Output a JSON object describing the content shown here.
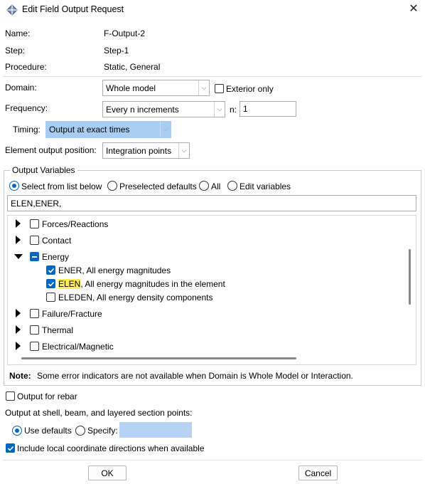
{
  "window": {
    "title": "Edit Field Output Request",
    "close_glyph": "✕"
  },
  "info": {
    "name_label": "Name:",
    "name_value": "F-Output-2",
    "step_label": "Step:",
    "step_value": "Step-1",
    "procedure_label": "Procedure:",
    "procedure_value": "Static, General"
  },
  "domain": {
    "label": "Domain:",
    "value": "Whole model",
    "exterior_label": "Exterior only",
    "exterior_checked": false
  },
  "frequency": {
    "label": "Frequency:",
    "value": "Every n increments",
    "n_label": "n:",
    "n_value": "1"
  },
  "timing": {
    "label": "Timing:",
    "value": "Output at exact times"
  },
  "element_position": {
    "label": "Element output position:",
    "value": "Integration points"
  },
  "output_variables": {
    "group_label": "Output Variables",
    "mode_options": [
      "Select from list below",
      "Preselected defaults",
      "All",
      "Edit variables"
    ],
    "selected_mode": "Select from list below",
    "text_value": "ELEN,ENER,",
    "tree": {
      "forces": "Forces/Reactions",
      "contact": "Contact",
      "energy": "Energy",
      "ener_desc": "ENER, All energy magnitudes",
      "elen_code": "ELEN",
      "elen_desc": ", All energy magnitudes in the element",
      "eleden_desc": "ELEDEN, All energy density components",
      "failure": "Failure/Fracture",
      "thermal": "Thermal",
      "electrical": "Electrical/Magnetic"
    },
    "note_label": "Note:",
    "note_text": "Some error indicators are not available when Domain is Whole Model or Interaction."
  },
  "rebar": {
    "label": "Output for rebar",
    "checked": false
  },
  "section_points": {
    "label": "Output at shell, beam, and layered section points:",
    "use_defaults_label": "Use defaults",
    "specify_label": "Specify:",
    "specify_value": ""
  },
  "local_coords": {
    "label": "Include local coordinate directions when available",
    "checked": true
  },
  "buttons": {
    "ok": "OK",
    "cancel": "Cancel"
  },
  "colors": {
    "accent": "#0067c0",
    "highlight": "#ffec5c",
    "combo_blue": "#a9cdf2"
  }
}
